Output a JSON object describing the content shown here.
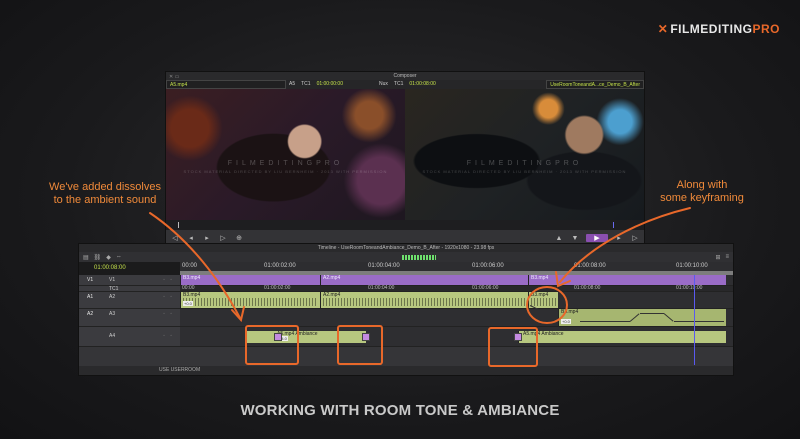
{
  "logo": {
    "mark": "✕",
    "main": "FILMEDITING",
    "accent": "PRO"
  },
  "composer": {
    "title": "Composer",
    "source_clip": "A5.mp4",
    "src_track": "A5",
    "src_tc_label": "TC1",
    "src_tc": "01:00:00:00",
    "rec_label": "Nux",
    "rec_tc_label": "TC1",
    "rec_tc": "01:00:08:00",
    "record_clip": "UseRoomToneandA...ce_Demo_B_After",
    "watermark": "FILMEDITINGPRO",
    "watermark_sub": "STOCK MATERIAL DIRECTED BY LIU BERNHEIM · 2013 WITH PERMISSION"
  },
  "timeline": {
    "title": "Timeline - UseRoomToneandAmbiance_Demo_B_After - 1920x1080 - 23.98 fps",
    "master_tc": "01:00:08:00",
    "ruler_ticks": [
      "00:00",
      "01:00:02:00",
      "01:00:04:00",
      "01:00:06:00",
      "01:00:08:00",
      "01:00:10:00"
    ],
    "ruler_ticks_lower": [
      "00:00",
      "01:00:02:00",
      "01:00:04:00",
      "01:00:06:00",
      "01:00:08:00",
      "01:00:10:00"
    ],
    "tracks": {
      "v1": {
        "rec": "V1",
        "src": "V1"
      },
      "tc": {
        "label": "TC1"
      },
      "a1": {
        "src": "A1",
        "rec": "A2"
      },
      "a2": {
        "src": "A2",
        "rec": "A3"
      },
      "a3": {
        "rec": "A4"
      }
    },
    "clips": {
      "v_clip1": "B3.mp4",
      "v_clip2": "A2.mp4",
      "v_clip3": "B3.mp4",
      "a_clip1": "B3.mp4",
      "a_clip2": "A2.mp4",
      "a_clip3": "B3.mp4",
      "a2_clip1": "B3.mp4",
      "a3_clip1": "A5.mp4 Ambiance",
      "a3_clip2": "A5.mp4 Ambiance"
    },
    "levels": {
      "a_lvl1": "+0.0",
      "a3_lvl": "-4.0",
      "a2_lvl": "+0.0"
    },
    "status_text": "USE USERROOM"
  },
  "annotations": {
    "left": "We've added dissolves\nto the ambient sound",
    "right": "Along with\nsome keyframing"
  },
  "caption": "WORKING WITH ROOM TONE & AMBIANCE",
  "colors": {
    "accent": "#e8682a",
    "timecode": "#c4e14a",
    "video_track": "#9a6cc7",
    "audio_track": "#b7c77f"
  }
}
